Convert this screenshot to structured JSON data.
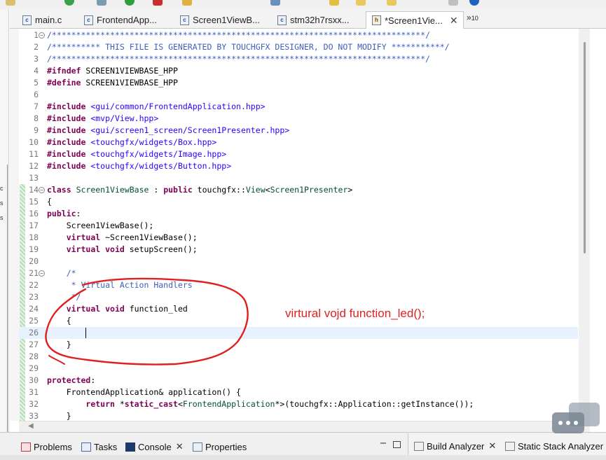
{
  "tabs": [
    {
      "label": "main.c",
      "icon": "c-file-icon",
      "active": false
    },
    {
      "label": "FrontendApp...",
      "icon": "c-file-icon",
      "active": false
    },
    {
      "label": "Screen1ViewB...",
      "icon": "c-file-icon",
      "active": false
    },
    {
      "label": "stm32h7rsxx...",
      "icon": "c-file-icon",
      "active": false
    },
    {
      "label": "*Screen1Vie...",
      "icon": "h-file-icon",
      "active": true
    }
  ],
  "tab_overflow": {
    "symbol": "»",
    "count": "10"
  },
  "code_lines": [
    {
      "n": "1",
      "fold": "−",
      "tokens": [
        [
          "cm",
          "/*****************************************************************************/"
        ]
      ]
    },
    {
      "n": "2",
      "tokens": [
        [
          "cm",
          "/********** THIS FILE IS GENERATED BY TOUCHGFX DESIGNER, DO NOT MODIFY ***********/"
        ]
      ]
    },
    {
      "n": "3",
      "tokens": [
        [
          "cm",
          "/*****************************************************************************/"
        ]
      ]
    },
    {
      "n": "4",
      "tokens": [
        [
          "pp",
          "#ifndef"
        ],
        [
          "plain",
          " SCREEN1VIEWBASE_HPP"
        ]
      ]
    },
    {
      "n": "5",
      "tokens": [
        [
          "pp",
          "#define"
        ],
        [
          "plain",
          " SCREEN1VIEWBASE_HPP"
        ]
      ]
    },
    {
      "n": "6",
      "tokens": []
    },
    {
      "n": "7",
      "tokens": [
        [
          "pp",
          "#include"
        ],
        [
          "plain",
          " "
        ],
        [
          "inc",
          "<gui/common/FrontendApplication.hpp>"
        ]
      ]
    },
    {
      "n": "8",
      "tokens": [
        [
          "pp",
          "#include"
        ],
        [
          "plain",
          " "
        ],
        [
          "inc",
          "<mvp/View.hpp>"
        ]
      ]
    },
    {
      "n": "9",
      "tokens": [
        [
          "pp",
          "#include"
        ],
        [
          "plain",
          " "
        ],
        [
          "inc",
          "<gui/screen1_screen/Screen1Presenter.hpp>"
        ]
      ]
    },
    {
      "n": "10",
      "tokens": [
        [
          "pp",
          "#include"
        ],
        [
          "plain",
          " "
        ],
        [
          "inc",
          "<touchgfx/widgets/Box.hpp>"
        ]
      ]
    },
    {
      "n": "11",
      "tokens": [
        [
          "pp",
          "#include"
        ],
        [
          "plain",
          " "
        ],
        [
          "inc",
          "<touchgfx/widgets/Image.hpp>"
        ]
      ]
    },
    {
      "n": "12",
      "tokens": [
        [
          "pp",
          "#include"
        ],
        [
          "plain",
          " "
        ],
        [
          "inc",
          "<touchgfx/widgets/Button.hpp>"
        ]
      ]
    },
    {
      "n": "13",
      "tokens": []
    },
    {
      "n": "14",
      "fold": "−",
      "tokens": [
        [
          "kw",
          "class"
        ],
        [
          "plain",
          " "
        ],
        [
          "ty",
          "Screen1ViewBase"
        ],
        [
          "plain",
          " : "
        ],
        [
          "kw",
          "public"
        ],
        [
          "plain",
          " touchgfx::"
        ],
        [
          "ty",
          "View"
        ],
        [
          "plain",
          "<"
        ],
        [
          "ty",
          "Screen1Presenter"
        ],
        [
          "plain",
          ">"
        ]
      ]
    },
    {
      "n": "15",
      "tokens": [
        [
          "plain",
          "{"
        ]
      ]
    },
    {
      "n": "16",
      "tokens": [
        [
          "kw",
          "public"
        ],
        [
          "plain",
          ":"
        ]
      ]
    },
    {
      "n": "17",
      "tokens": [
        [
          "plain",
          "    Screen1ViewBase();"
        ]
      ]
    },
    {
      "n": "18",
      "tokens": [
        [
          "plain",
          "    "
        ],
        [
          "kw",
          "virtual"
        ],
        [
          "plain",
          " ~Screen1ViewBase();"
        ]
      ]
    },
    {
      "n": "19",
      "tokens": [
        [
          "plain",
          "    "
        ],
        [
          "kw",
          "virtual"
        ],
        [
          "plain",
          " "
        ],
        [
          "kw",
          "void"
        ],
        [
          "plain",
          " setupScreen();"
        ]
      ]
    },
    {
      "n": "20",
      "tokens": []
    },
    {
      "n": "21",
      "fold": "−",
      "tokens": [
        [
          "cm",
          "    /*"
        ]
      ]
    },
    {
      "n": "22",
      "tokens": [
        [
          "cm",
          "     * Virtual Action Handlers"
        ]
      ]
    },
    {
      "n": "23",
      "tokens": [
        [
          "cm",
          "     */"
        ]
      ]
    },
    {
      "n": "24",
      "tokens": [
        [
          "plain",
          "    "
        ],
        [
          "kw",
          "virtual"
        ],
        [
          "plain",
          " "
        ],
        [
          "kw",
          "void"
        ],
        [
          "plain",
          " function_led"
        ]
      ]
    },
    {
      "n": "25",
      "tokens": [
        [
          "plain",
          "    {"
        ]
      ]
    },
    {
      "n": "26",
      "current": true,
      "caret": true,
      "tokens": [
        [
          "plain",
          "        "
        ]
      ]
    },
    {
      "n": "27",
      "tokens": [
        [
          "plain",
          "    }"
        ]
      ]
    },
    {
      "n": "28",
      "tokens": []
    },
    {
      "n": "29",
      "tokens": []
    },
    {
      "n": "30",
      "tokens": [
        [
          "kw",
          "protected"
        ],
        [
          "plain",
          ":"
        ]
      ]
    },
    {
      "n": "31",
      "tokens": [
        [
          "plain",
          "    FrontendApplication& application() {"
        ]
      ]
    },
    {
      "n": "32",
      "tokens": [
        [
          "plain",
          "        "
        ],
        [
          "kw",
          "return"
        ],
        [
          "plain",
          " *"
        ],
        [
          "kw",
          "static_cast"
        ],
        [
          "plain",
          "<"
        ],
        [
          "ty",
          "FrontendApplication"
        ],
        [
          "plain",
          "*>(touchgfx::Application::getInstance());"
        ]
      ]
    },
    {
      "n": "33",
      "tokens": [
        [
          "plain",
          "    }"
        ]
      ]
    }
  ],
  "annotation": {
    "text": "virtural vojd function_led();",
    "color": "#e02020"
  },
  "left_strip_marks": [
    "c",
    "s",
    "s"
  ],
  "bottom_tabs": [
    {
      "label": "Problems",
      "icon": "problems-icon"
    },
    {
      "label": "Tasks",
      "icon": "tasks-icon"
    },
    {
      "label": "Console",
      "icon": "console-icon",
      "closable": true
    },
    {
      "label": "Properties",
      "icon": "properties-icon"
    }
  ],
  "right_tabs": [
    {
      "label": "Build Analyzer",
      "icon": "build-analyzer-icon",
      "closable": true
    },
    {
      "label": "Static Stack Analyzer",
      "icon": "stack-analyzer-icon"
    }
  ],
  "close_symbol": "✕",
  "minimize_symbol": "−"
}
